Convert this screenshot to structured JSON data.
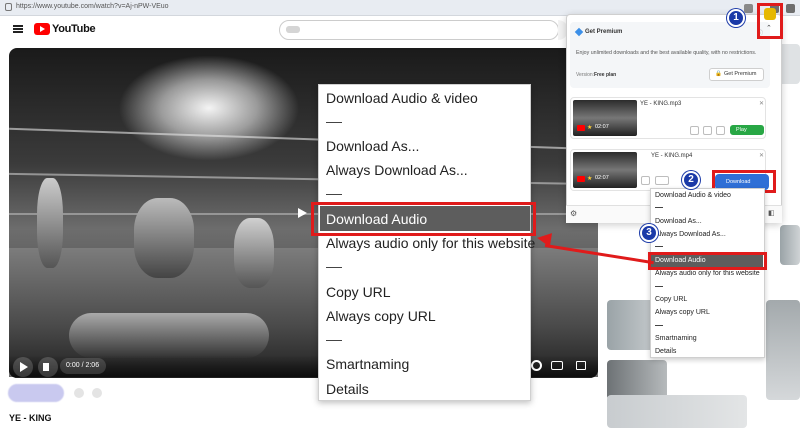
{
  "browser": {
    "url": "https://www.youtube.com/watch?v=Aj-nPW-VEuo"
  },
  "youtube": {
    "logo_text": "YouTube",
    "video_title": "YE - KING",
    "time": "0:00 / 2:06"
  },
  "context_menu": {
    "items": [
      "Download Audio & video",
      "Download As...",
      "Always Download As...",
      "Download Audio",
      "Always audio only for this website",
      "Copy URL",
      "Always copy URL",
      "Smartnaming",
      "Details"
    ],
    "highlighted": "Download Audio"
  },
  "extension_popup": {
    "premium_title": "Get Premium",
    "premium_text": "Enjoy unlimited downloads and the best available quality, with no restrictions.",
    "version_label": "Version:",
    "version_value": "Free plan",
    "get_premium_button": "Get Premium",
    "items": [
      {
        "name": "YE - KING.mp3",
        "duration": "02:07",
        "action": "Play"
      },
      {
        "name": "YE - KING.mp4",
        "duration": "02:07",
        "action": "Download"
      }
    ]
  },
  "dropdown_menu": {
    "items": [
      "Download Audio & video",
      "Download As...",
      "Always Download As...",
      "Download Audio",
      "Always audio only for this website",
      "Copy URL",
      "Always copy URL",
      "Smartnaming",
      "Details"
    ],
    "highlighted": "Download Audio"
  },
  "steps": [
    "1",
    "2",
    "3"
  ],
  "colors": {
    "annotation_red": "#e01b1b",
    "badge_blue": "#1b3aa8",
    "download_blue": "#2f6fd6",
    "play_green": "#28a745",
    "youtube_red": "#ff0000"
  }
}
